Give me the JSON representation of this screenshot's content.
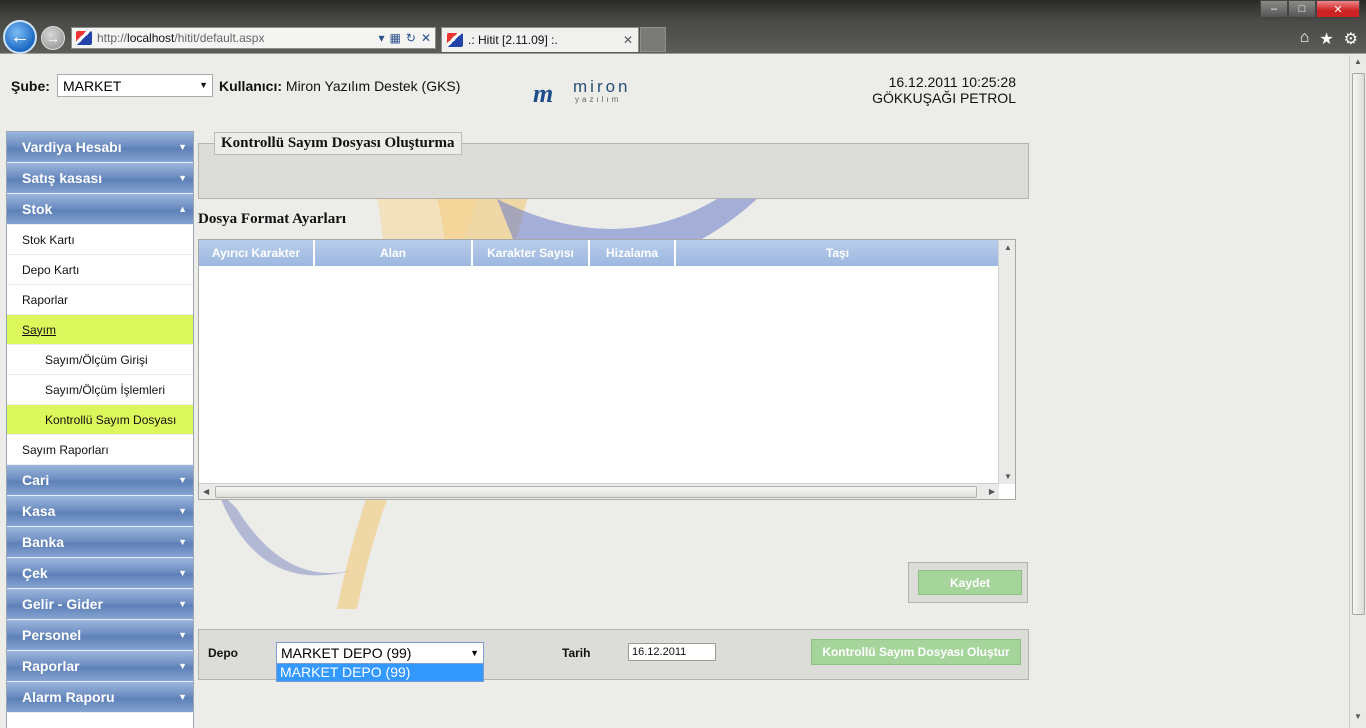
{
  "browser": {
    "url_prefix": "http://",
    "url_host": "localhost",
    "url_path": "/hitit/default.aspx",
    "tab_title": ".: Hitit [2.11.09] :."
  },
  "header": {
    "sube_label": "Şube:",
    "sube_value": "MARKET",
    "user_label": "Kullanıcı:",
    "user_value": "Miron Yazılım Destek (GKS)",
    "logo_name": "miron",
    "logo_sub": "yazılım",
    "datetime": "16.12.2011 10:25:28",
    "company": "GÖKKUŞAĞI PETROL"
  },
  "sidebar": {
    "vardiya": "Vardiya Hesabı",
    "satis": "Satış kasası",
    "stok": "Stok",
    "stok_karti": "Stok Kartı",
    "depo_karti": "Depo Kartı",
    "raporlar_sub": "Raporlar",
    "sayim": "Sayım",
    "sayim_giris": "Sayım/Ölçüm Girişi",
    "sayim_islem": "Sayım/Ölçüm İşlemleri",
    "kontrollu": "Kontrollü Sayım Dosyası",
    "sayim_rapor": "Sayım Raporları",
    "cari": "Cari",
    "kasa": "Kasa",
    "banka": "Banka",
    "cek": "Çek",
    "gelir": "Gelir - Gider",
    "personel": "Personel",
    "raporlar": "Raporlar",
    "alarm": "Alarm Raporu"
  },
  "main": {
    "panel_title": "Kontrollü Sayım Dosyası Oluşturma",
    "format_title": "Dosya Format Ayarları",
    "columns": [
      "Ayırıcı Karakter",
      "Alan",
      "Karakter Sayısı",
      "Hizalama",
      "Taşı"
    ],
    "save_label": "Kaydet",
    "depo_label": "Depo",
    "depo_value": "MARKET DEPO (99)",
    "depo_option": "MARKET DEPO (99)",
    "tarih_label": "Tarih",
    "tarih_value": "16.12.2011",
    "create_label": "Kontrollü Sayım Dosyası Oluştur"
  },
  "colors": {
    "menu_head": "#6f8fc2",
    "active_item": "#dcf75c",
    "grid_head": "#9cb7e0",
    "button_green": "#a6d59c",
    "selected_option": "#3399ff"
  }
}
